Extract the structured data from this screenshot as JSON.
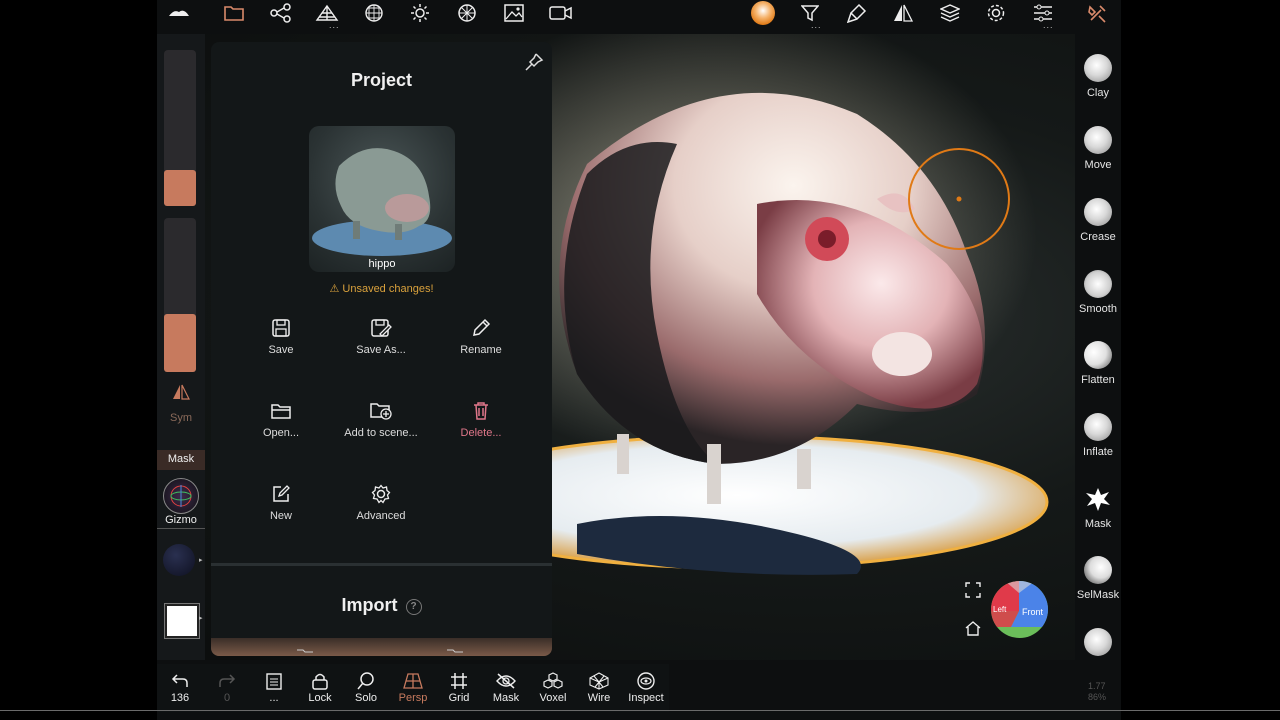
{
  "topbar": {
    "icons": [
      "logo-icon",
      "folder-icon",
      "share-icon",
      "scene-icon",
      "mesh-icon",
      "light-icon",
      "material-icon",
      "image-icon",
      "camera-icon",
      "matcap-icon",
      "filter-icon",
      "brush-icon",
      "symmetry-icon",
      "layers-icon",
      "settings-icon",
      "sliders-icon",
      "tools-icon"
    ]
  },
  "leftbar": {
    "sym_label": "Sym",
    "mask_label": "Mask",
    "gizmo_label": "Gizmo"
  },
  "project": {
    "title": "Project",
    "thumbnail_name": "hippo",
    "warning": "⚠ Unsaved changes!",
    "actions": [
      {
        "label": "Save",
        "icon": "save-icon"
      },
      {
        "label": "Save As...",
        "icon": "save-as-icon"
      },
      {
        "label": "Rename",
        "icon": "pencil-icon"
      },
      {
        "label": "Open...",
        "icon": "open-folder-icon"
      },
      {
        "label": "Add to scene...",
        "icon": "add-folder-icon"
      },
      {
        "label": "Delete...",
        "icon": "trash-icon"
      },
      {
        "label": "New",
        "icon": "new-icon"
      },
      {
        "label": "Advanced",
        "icon": "gear-icon"
      }
    ],
    "import_title": "Import",
    "import_help": "?"
  },
  "tools": [
    {
      "label": "Clay"
    },
    {
      "label": "Move"
    },
    {
      "label": "Crease"
    },
    {
      "label": "Smooth"
    },
    {
      "label": "Flatten"
    },
    {
      "label": "Inflate"
    },
    {
      "label": "Mask"
    },
    {
      "label": "SelMask"
    }
  ],
  "bottombar": {
    "undo_count": "136",
    "redo_count": "0",
    "items": [
      "...",
      "Lock",
      "Solo",
      "Persp",
      "Grid",
      "Mask",
      "Voxel",
      "Wire",
      "Inspect"
    ]
  },
  "viewcube": {
    "left": "Left",
    "front": "Front"
  },
  "stats": {
    "line1": "1.77",
    "line2": "86%"
  },
  "colors": {
    "accent": "#c77a5e",
    "warning": "#d9a13c",
    "delete": "#e0778a",
    "brush_ring": "#e07a16"
  }
}
